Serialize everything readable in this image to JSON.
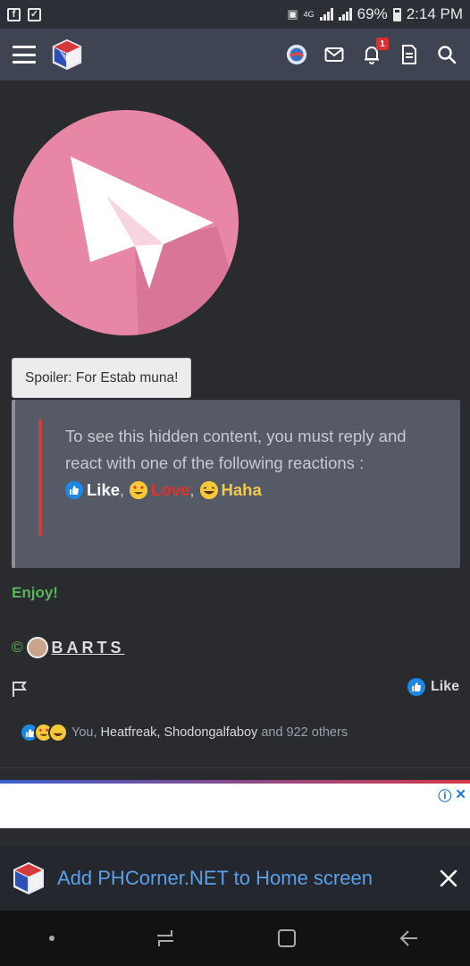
{
  "status_bar": {
    "network": "4G",
    "battery_percent": "69%",
    "time": "2:14 PM"
  },
  "nav": {
    "notification_badge": "1"
  },
  "spoiler": {
    "label": "Spoiler: For Estab muna!",
    "hidden_message": "To see this hidden content, you must reply and react with one of the following reactions :",
    "reactions": [
      {
        "label": "Like",
        "color": "#ffffff",
        "icon": "like-icon"
      },
      {
        "label": "Love",
        "color": "#e0312d",
        "icon": "love-icon"
      },
      {
        "label": "Haha",
        "color": "#f2c94c",
        "icon": "haha-icon"
      }
    ],
    "separator": ","
  },
  "post": {
    "enjoy_text": "Enjoy!",
    "copyright_symbol": "©",
    "author_name": "BARTS",
    "like_label": "Like"
  },
  "reactions_summary": {
    "you": "You,",
    "user1": "Heatfreak,",
    "user2": "Shodongalfaboy",
    "and_others": "and 922 others"
  },
  "add_to_home": {
    "label": "Add PHCorner.NET to Home screen"
  },
  "colors": {
    "accent_green": "#5ab45a",
    "like_blue": "#1e88e5",
    "love_red": "#e0312d",
    "haha_yellow": "#f2c94c",
    "link_blue": "#5aa0e8"
  }
}
